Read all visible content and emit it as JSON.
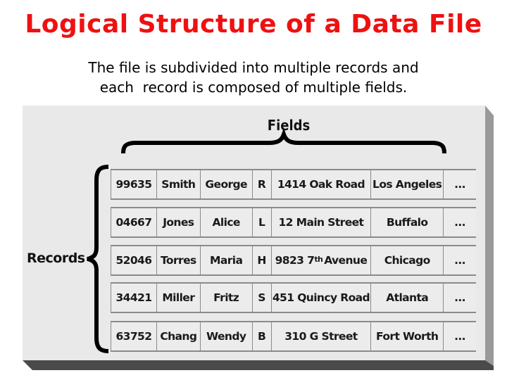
{
  "title": "Logical Structure of a Data File",
  "subtitle": {
    "line1": "The file is subdivided into multiple records and",
    "line2": "each  record is composed of multiple fields."
  },
  "diagram": {
    "fields_label": "Fields",
    "records_label": "Records",
    "records": [
      [
        "99635",
        "Smith",
        "George",
        "R",
        "1414 Oak Road",
        "Los Angeles",
        "..."
      ],
      [
        "04667",
        "Jones",
        "Alice",
        "L",
        "12 Main Street",
        "Buffalo",
        "..."
      ],
      [
        "52046",
        "Torres",
        "Maria",
        "H",
        "9823 7th Avenue",
        "Chicago",
        "..."
      ],
      [
        "34421",
        "Miller",
        "Fritz",
        "S",
        "451 Quincy Road",
        "Atlanta",
        "..."
      ],
      [
        "63752",
        "Chang",
        "Wendy",
        "B",
        "310 G Street",
        "Fort Worth",
        "..."
      ]
    ],
    "superscript_parts": {
      "2-4": {
        "before": "9823 7",
        "sup": "th",
        "after": " Avenue"
      }
    }
  }
}
